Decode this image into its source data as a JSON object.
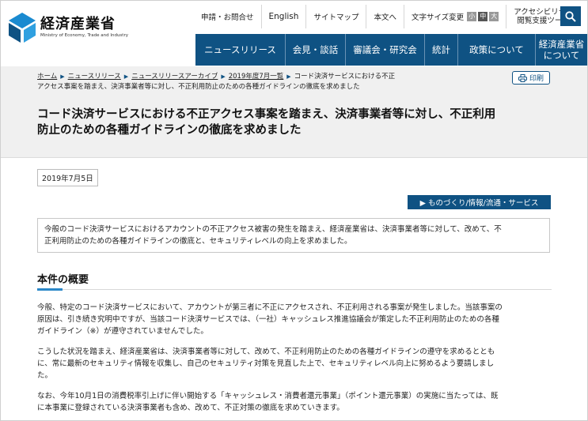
{
  "header": {
    "org_name_ja": "経済産業省",
    "org_name_en": "Ministry of Economy, Trade and Industry",
    "utility": {
      "apply": "申請・お問合せ",
      "english": "English",
      "sitemap": "サイトマップ",
      "text_link": "本文へ",
      "font_size_label": "文字サイズ変更",
      "size_small": "小",
      "size_medium": "中",
      "size_large": "大",
      "accessibility_line1": "アクセシビリティ",
      "accessibility_line2": "閲覧支援ツール"
    },
    "search_icon": "search-icon",
    "nav": [
      {
        "label": "ニュースリリース"
      },
      {
        "label": "会見・談話"
      },
      {
        "label": "審議会・研究会"
      },
      {
        "label": "統計"
      },
      {
        "label": "政策について"
      },
      {
        "label_line1": "経済産業省",
        "label_line2": "について"
      }
    ]
  },
  "breadcrumb": {
    "home": "ホーム",
    "news": "ニュースリリース",
    "archive": "ニュースリリースアーカイブ",
    "year": "2019年度7月一覧",
    "current_line1": "コード決済サービスにおける不正",
    "current_line2": "アクセス事案を踏まえ、決済事業者等に対し、不正利用防止のための各種ガイドラインの徹底を求めました"
  },
  "print_label": "印刷",
  "title_line1": "コード決済サービスにおける不正アクセス事案を踏まえ、決済事業者等に対し、不正利用",
  "title_line2": "防止のための各種ガイドラインの徹底を求めました",
  "date": "2019年7月5日",
  "category": "▶ ものづくり/情報/流通・サービス",
  "summary_line1": "今般のコード決済サービスにおけるアカウントの不正アクセス被害の発生を踏まえ、経済産業省は、決済事業者等に対して、改めて、不",
  "summary_line2": "正利用防止のための各種ガイドラインの徹底と、セキュリティレベルの向上を求めました。",
  "section_heading": "本件の概要",
  "paragraphs": [
    {
      "l1": "今般、特定のコード決済サービスにおいて、アカウントが第三者に不正にアクセスされ、不正利用される事案が発生しました。当該事案の",
      "l2": "原因は、引き続き究明中ですが、当該コード決済サービスでは、（一社）キャッシュレス推進協議会が策定した不正利用防止のための各種",
      "l3": "ガイドライン（※）が遵守されていませんでした。"
    },
    {
      "l1": "こうした状況を踏まえ、経済産業省は、決済事業者等に対して、改めて、不正利用防止のための各種ガイドラインの遵守を求めるととも",
      "l2": "に、常に最新のセキュリティ情報を収集し、自己のセキュリティ対策を見直した上で、セキュリティレベル向上に努めるよう要請しまし",
      "l3": "た。"
    },
    {
      "l1": "なお、今年10月1日の消費税率引上げに伴い開始する「キャッシュレス・消費者還元事業」（ポイント還元事業）の実施に当たっては、既",
      "l2": "に本事業に登録されている決済事業者も含め、改めて、不正対策の徹底を求めていきます。"
    }
  ],
  "colors": {
    "brand_navy": "#0f5283",
    "accent_blue": "#2b88c8",
    "band_gray": "#f0f0f0"
  }
}
